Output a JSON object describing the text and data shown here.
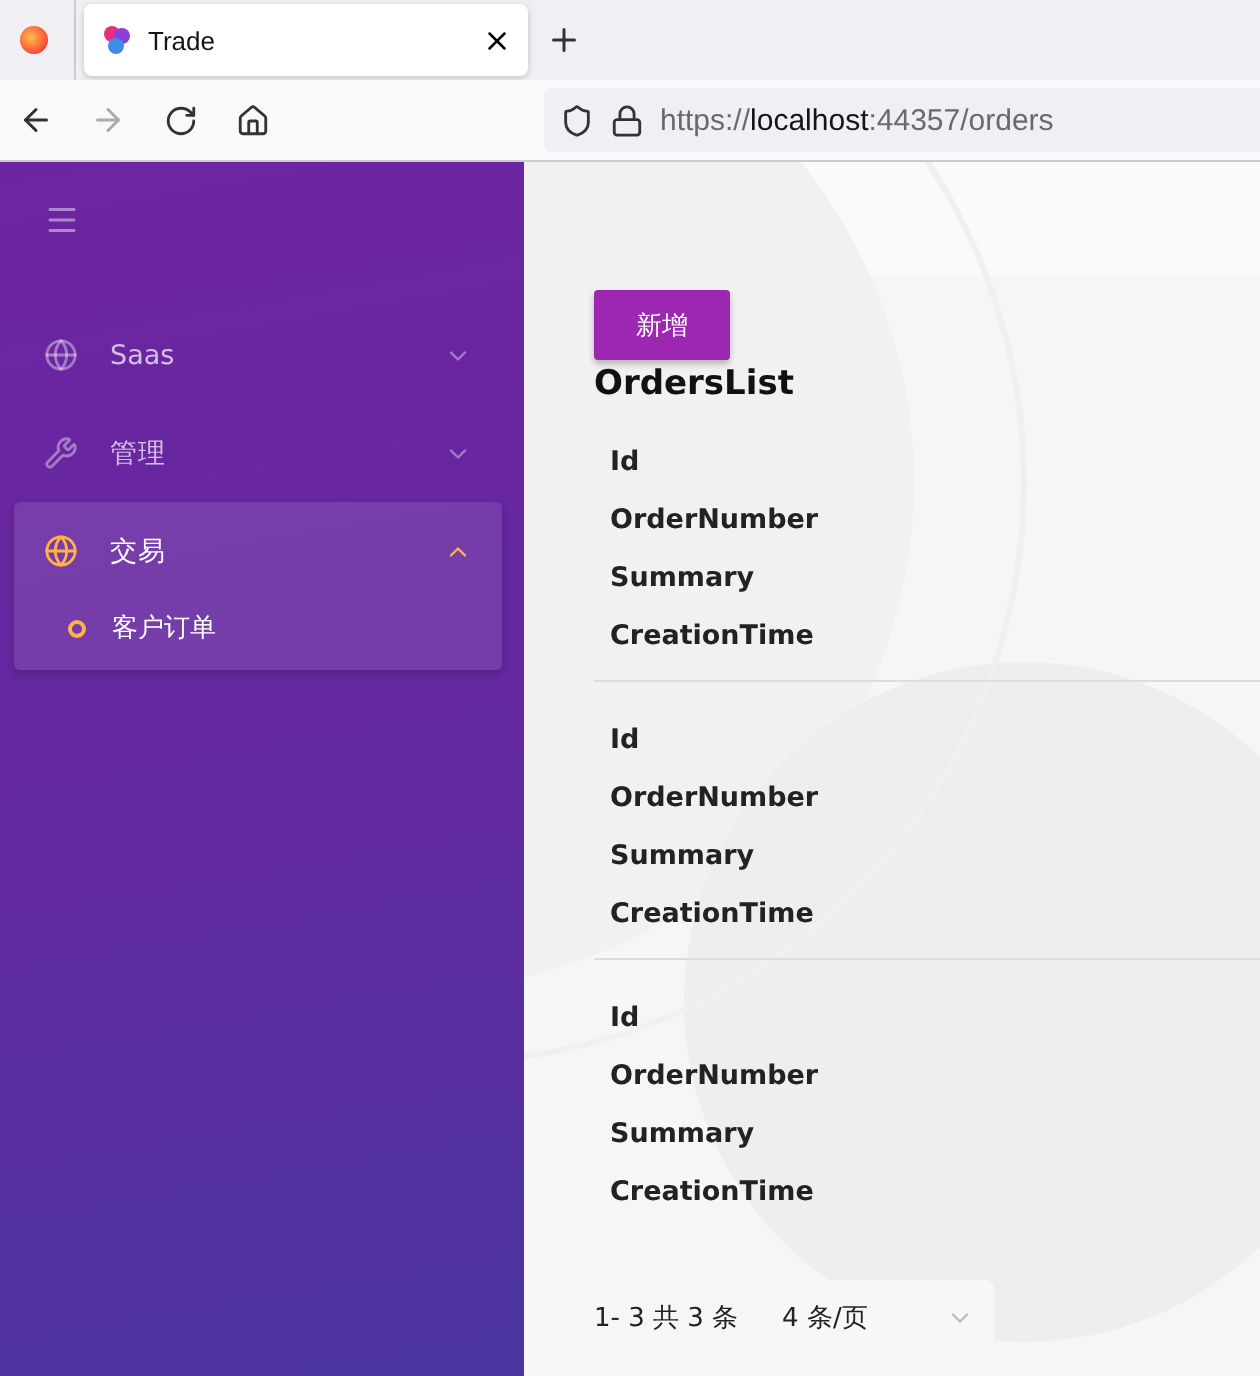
{
  "browser": {
    "tab_title": "Trade",
    "url_scheme": "https://",
    "url_host": "localhost",
    "url_rest": ":44357/orders"
  },
  "sidebar": {
    "items": [
      {
        "label": "Saas",
        "kind": "globe",
        "expanded": false,
        "selected": false
      },
      {
        "label": "管理",
        "kind": "wrench",
        "expanded": false,
        "selected": false
      },
      {
        "label": "交易",
        "kind": "globe",
        "expanded": true,
        "selected": true,
        "children": [
          {
            "label": "客户订单",
            "selected": true
          }
        ]
      }
    ]
  },
  "main": {
    "add_button": "新增",
    "title": "OrdersList",
    "records": [
      {
        "fields": [
          "Id",
          "OrderNumber",
          "Summary",
          "CreationTime"
        ]
      },
      {
        "fields": [
          "Id",
          "OrderNumber",
          "Summary",
          "CreationTime"
        ]
      },
      {
        "fields": [
          "Id",
          "OrderNumber",
          "Summary",
          "CreationTime"
        ]
      }
    ],
    "pagination": {
      "summary": "1- 3 共 3 条",
      "page_size": "4 条/页"
    }
  }
}
